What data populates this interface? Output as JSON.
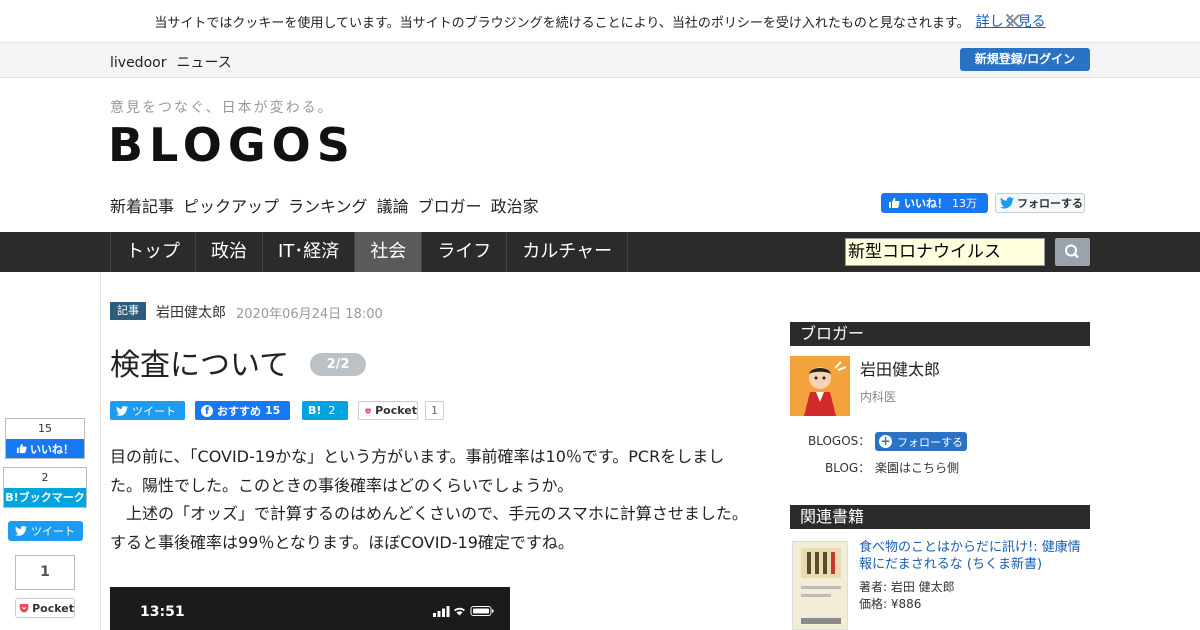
{
  "cookie": {
    "message": "当サイトではクッキーを使用しています。当サイトのブラウジングを続けることにより、当社のポリシーを受け入れたものと見なされます。",
    "link": "詳しく見る"
  },
  "strip": {
    "brand_1": "livedoor",
    "brand_2": "ニュース",
    "login": "新規登録/ログイン"
  },
  "header": {
    "tagline": "意見をつなぐ、日本が変わる。",
    "logo": "BLOGOS",
    "subnav": [
      "新着記事",
      "ピックアップ",
      "ランキング",
      "議論",
      "ブロガー",
      "政治家"
    ],
    "fb_like": "いいね！",
    "fb_count": "13万",
    "tw_follow": "フォローする"
  },
  "nav": {
    "tabs": [
      "トップ",
      "政治",
      "IT･経済",
      "社会",
      "ライフ",
      "カルチャー"
    ],
    "active": "社会",
    "search_value": "新型コロナウイルス"
  },
  "article": {
    "badge": "記事",
    "author": "岩田健太郎",
    "date": "2020年06月24日 18:00",
    "title": "検査について",
    "pager": "2/2",
    "share": {
      "tweet": "ツイート",
      "fb": "おすすめ",
      "fb_count": "15",
      "hb_count": "2",
      "pocket": "Pocket",
      "pocket_count": "1"
    },
    "paragraph_1": "目の前に、「COVID-19かな」という方がいます。事前確率は10％です。PCRをしました。陽性でした。このときの事後確率はどのくらいでしょうか。",
    "paragraph_2": "　上述の「オッズ」で計算するのはめんどくさいので、手元のスマホに計算させました。すると事後確率は99％となります。ほぼCOVID-19確定ですね。",
    "phone_time": "13:51"
  },
  "left_share": {
    "fb_count": "15",
    "fb_label": "いいね！",
    "hb_count": "2",
    "hb_label": "ブックマーク",
    "tweet": "ツイート",
    "pocket_count": "1",
    "pocket": "Pocket"
  },
  "sidebar": {
    "blogger_heading": "ブロガー",
    "blogger_name": "岩田健太郎",
    "blogger_role": "内科医",
    "blogos_label": "BLOGOS：",
    "follow": "フォローする",
    "blog_label": "BLOG：",
    "blog_name": "楽園はこちら側",
    "books_heading": "関連書籍",
    "book_title": "食べ物のことはからだに訊け!: 健康情報にだまされるな (ちくま新書)",
    "book_author": "著者: 岩田 健太郎",
    "book_price": "価格: ¥886"
  },
  "colors": {
    "nav_bg": "#2b2b2b",
    "accent_blue": "#2a72c4",
    "facebook": "#1877f2",
    "twitter": "#1d9bf0",
    "hatena": "#00a4de"
  }
}
